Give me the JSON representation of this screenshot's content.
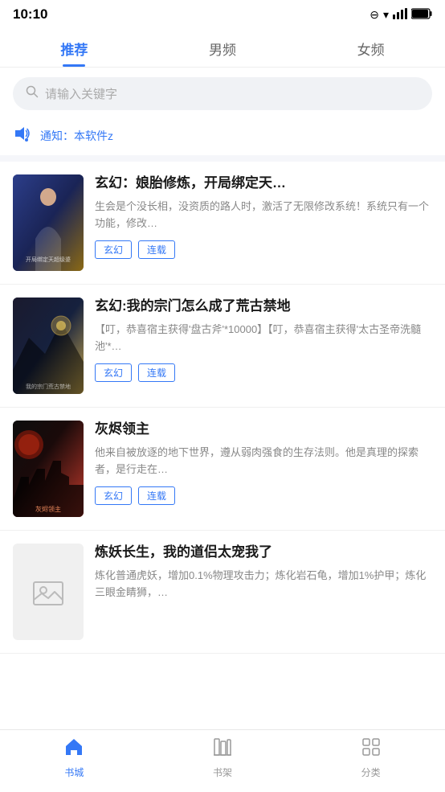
{
  "statusBar": {
    "time": "10:10",
    "icons": [
      "⊖",
      "▼",
      "▲",
      "🔋"
    ]
  },
  "topTabs": [
    {
      "id": "recommend",
      "label": "推荐",
      "active": true
    },
    {
      "id": "male",
      "label": "男频",
      "active": false
    },
    {
      "id": "female",
      "label": "女频",
      "active": false
    }
  ],
  "search": {
    "placeholder": "请输入关键字"
  },
  "notice": {
    "text": "通知：本软件z"
  },
  "books": [
    {
      "id": 1,
      "title": "玄幻：娘胎修炼，开局绑定天…",
      "description": "生会是个没长相，没资质的路人时，激活了无限修改系统！系统只有一个功能，修改…",
      "tags": [
        "玄幻",
        "连载"
      ],
      "coverType": "cover-1",
      "coverLabel": "开局绑定天超级婆"
    },
    {
      "id": 2,
      "title": "玄幻:我的宗门怎么成了荒古禁地",
      "description": "【叮，恭喜宿主获得'盘古斧'*10000】【叮，恭喜宿主获得'太古圣帝洗髓池'*…",
      "tags": [
        "玄幻",
        "连载"
      ],
      "coverType": "cover-2",
      "coverLabel": "我的宗门荒古禁地"
    },
    {
      "id": 3,
      "title": "灰烬领主",
      "description": "他来自被放逐的地下世界，遵从弱肉强食的生存法则。他是真理的探索者，是行走在…",
      "tags": [
        "玄幻",
        "连载"
      ],
      "coverType": "cover-3",
      "coverLabel": "灰烬领主"
    },
    {
      "id": 4,
      "title": "炼妖长生，我的道侣太宠我了",
      "description": "炼化普通虎妖，增加0.1%物理攻击力；炼化岩石龟，增加1%护甲；炼化三眼金睛狮，…",
      "tags": [],
      "coverType": "placeholder",
      "coverLabel": ""
    }
  ],
  "bottomNav": [
    {
      "id": "bookstore",
      "label": "书城",
      "active": true,
      "icon": "🏠"
    },
    {
      "id": "bookshelf",
      "label": "书架",
      "active": false,
      "icon": "📚"
    },
    {
      "id": "category",
      "label": "分类",
      "active": false,
      "icon": "⊞"
    }
  ]
}
